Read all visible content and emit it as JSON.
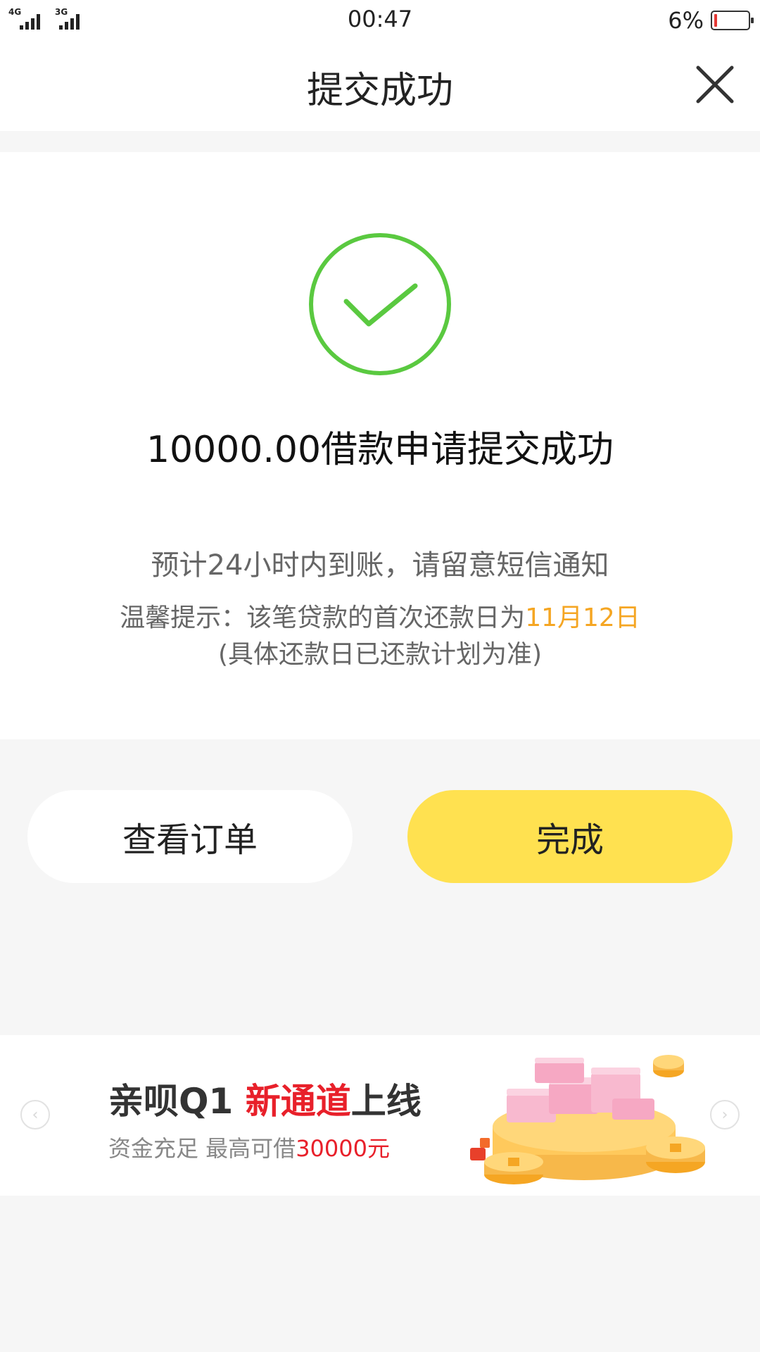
{
  "status_bar": {
    "network_1": "4G",
    "network_2": "3G",
    "time": "00:47",
    "battery_percent": "6%",
    "battery_level": 0.06
  },
  "nav": {
    "title": "提交成功"
  },
  "result": {
    "title": "10000.00借款申请提交成功",
    "eta": "预计24小时内到账，请留意短信通知",
    "tip_prefix": "温馨提示：该笔贷款的首次还款日为",
    "tip_date": "11月12日",
    "tip_note": "(具体还款日已还款计划为准)"
  },
  "actions": {
    "view_order_label": "查看订单",
    "done_label": "完成"
  },
  "banner": {
    "headline_part1": "亲呗Q1 ",
    "headline_highlight": "新通道",
    "headline_part2": "上线",
    "sub_prefix": "资金充足 最高可借",
    "sub_amount": "30000元"
  },
  "colors": {
    "success_green": "#5ac940",
    "accent_yellow": "#ffe150",
    "date_orange": "#f5a623",
    "promo_red": "#e8202a"
  },
  "icons": {
    "close": "close-icon",
    "check": "check-circle-icon",
    "prev": "chevron-left-icon",
    "next": "chevron-right-icon"
  }
}
